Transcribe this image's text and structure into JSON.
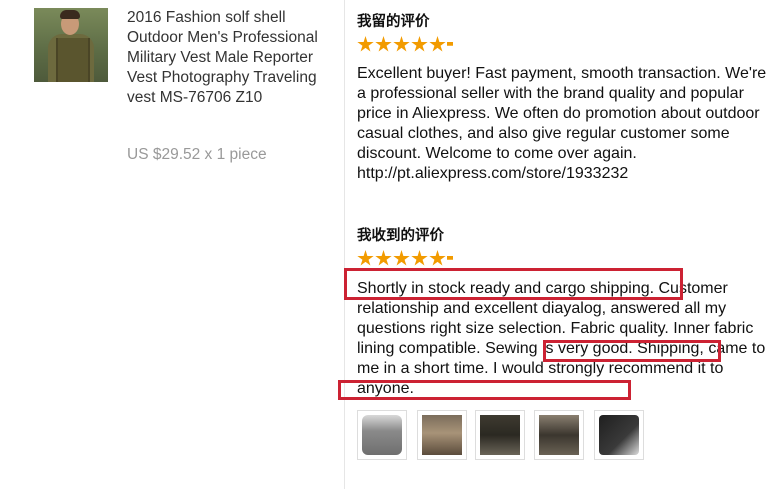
{
  "product": {
    "title": "2016 Fashion solf shell Outdoor Men's Professional Military Vest Male Reporter Vest Photography Traveling vest MS-76706 Z10",
    "price": "US $29.52 x 1 piece",
    "image_alt": "product photo: man wearing olive vest"
  },
  "my_review": {
    "heading": "我留的评价",
    "rating": 5,
    "text": "Excellent buyer! Fast payment, smooth transaction. We're a professional seller with the brand quality and popular price in Aliexpress. We often do promotion about outdoor casual clothes, and also give regular customer some discount. Welcome to come over again. http://pt.aliexpress.com/store/1933232"
  },
  "received_review": {
    "heading": "我收到的评价",
    "rating": 5,
    "text": "Shortly in stock ready and cargo shipping. Customer relationship and excellent diayalog, answered all my questions right size selection. Fabric quality. Inner fabric lining compatible. Sewing is very good. Shipping, came to me in a short time. I would strongly recommend it to anyone.",
    "photos": [
      {
        "name": "review-photo-1"
      },
      {
        "name": "review-photo-2"
      },
      {
        "name": "review-photo-3"
      },
      {
        "name": "review-photo-4"
      },
      {
        "name": "review-photo-5"
      }
    ]
  },
  "colors": {
    "star": "#f29b00",
    "highlight": "#cc2233",
    "price": "#999999"
  }
}
